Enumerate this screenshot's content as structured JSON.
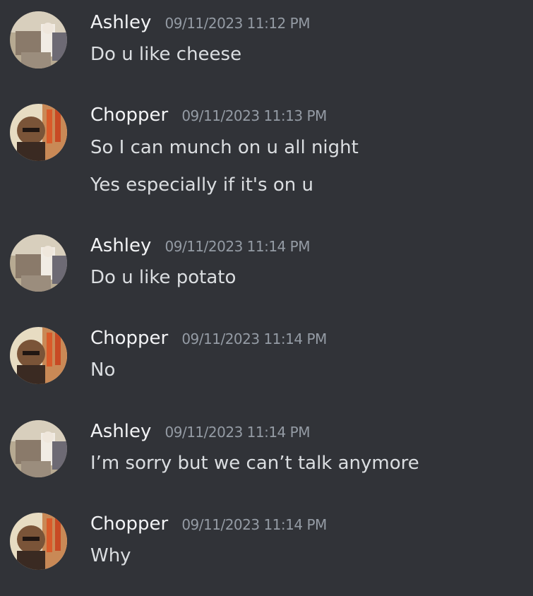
{
  "messages": [
    {
      "author": "Ashley",
      "avatar_icon": "ashley-avatar-icon",
      "timestamp": "09/11/2023 11:12 PM",
      "lines": [
        "Do u like cheese"
      ]
    },
    {
      "author": "Chopper",
      "avatar_icon": "chopper-avatar-icon",
      "timestamp": "09/11/2023 11:13 PM",
      "lines": [
        "So I can munch on u all night",
        "Yes especially if it's on u"
      ]
    },
    {
      "author": "Ashley",
      "avatar_icon": "ashley-avatar-icon",
      "timestamp": "09/11/2023 11:14 PM",
      "lines": [
        "Do u like potato"
      ]
    },
    {
      "author": "Chopper",
      "avatar_icon": "chopper-avatar-icon",
      "timestamp": "09/11/2023 11:14 PM",
      "lines": [
        "No"
      ]
    },
    {
      "author": "Ashley",
      "avatar_icon": "ashley-avatar-icon",
      "timestamp": "09/11/2023 11:14 PM",
      "lines": [
        "I’m sorry but we can’t talk anymore"
      ]
    },
    {
      "author": "Chopper",
      "avatar_icon": "chopper-avatar-icon",
      "timestamp": "09/11/2023 11:14 PM",
      "lines": [
        "Why"
      ]
    }
  ],
  "colors": {
    "background": "#313338",
    "username": "#f2f3f5",
    "timestamp": "#949ba4",
    "message_text": "#dbdee1"
  }
}
